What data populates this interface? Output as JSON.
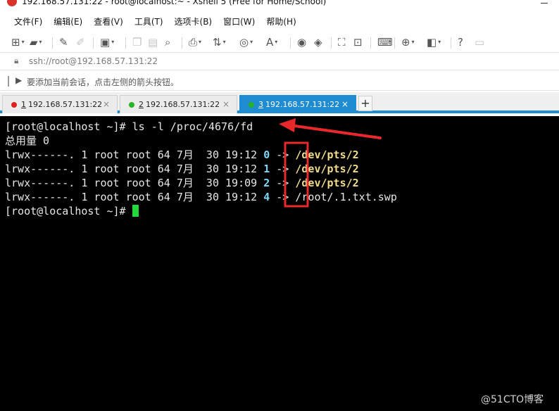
{
  "window": {
    "title": "192.168.57.131:22 - root@localhost:~ - Xshell 5 (Free for Home/School)"
  },
  "menu": [
    "文件(F)",
    "编辑(E)",
    "查看(V)",
    "工具(T)",
    "选项卡(B)",
    "窗口(W)",
    "帮助(H)"
  ],
  "address": {
    "value": "ssh://root@192.168.57.131:22"
  },
  "hint": "要添加当前会话，点击左侧的箭头按钮。",
  "tabs": [
    {
      "num": "1",
      "label": "192.168.57.131:22",
      "status_color": "#e02020",
      "active": false
    },
    {
      "num": "2",
      "label": "192.168.57.131:22",
      "status_color": "#27b327",
      "active": false
    },
    {
      "num": "3",
      "label": "192.168.57.131:22",
      "status_color": "#27b327",
      "active": true
    }
  ],
  "tab_add": "+",
  "terminal": {
    "command": "[root@localhost ~]# ls -l /proc/4676/fd",
    "total": "总用量 0",
    "entries": [
      {
        "perms": "lrwx------. 1 root root 64 7月  30 19:12",
        "fd": "0",
        "arrow": "->",
        "target": "/dev/pts/2",
        "highlight": true
      },
      {
        "perms": "lrwx------. 1 root root 64 7月  30 19:12",
        "fd": "1",
        "arrow": "->",
        "target": "/dev/pts/2",
        "highlight": true
      },
      {
        "perms": "lrwx------. 1 root root 64 7月  30 19:09",
        "fd": "2",
        "arrow": "->",
        "target": "/dev/pts/2",
        "highlight": true
      },
      {
        "perms": "lrwx------. 1 root root 64 7月  30 19:12",
        "fd": "4",
        "arrow": "->",
        "target": "/root/.1.txt.swp",
        "highlight": false
      }
    ],
    "prompt": "[root@localhost ~]# "
  },
  "watermark": "@51CTO博客",
  "colors": {
    "accent": "#1f8bd1",
    "terminal_bg": "#000000",
    "annotation": "#e8282b",
    "cursor": "#22d83c"
  }
}
